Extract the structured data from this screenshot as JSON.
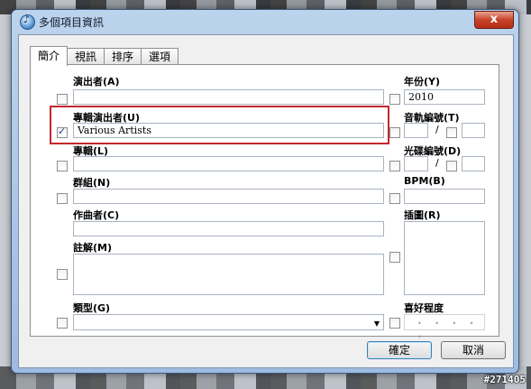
{
  "window": {
    "title": "多個項目資訊",
    "close_label": "x"
  },
  "tabs": [
    {
      "label": "簡介",
      "active": true
    },
    {
      "label": "視訊",
      "active": false
    },
    {
      "label": "排序",
      "active": false
    },
    {
      "label": "選項",
      "active": false
    }
  ],
  "fields": {
    "artist": {
      "label": "演出者(A)",
      "value": "",
      "checked": false
    },
    "album_artist": {
      "label": "專輯演出者(U)",
      "value": "Various Artists",
      "checked": true
    },
    "album": {
      "label": "專輯(L)",
      "value": "",
      "checked": false
    },
    "grouping": {
      "label": "群組(N)",
      "value": "",
      "checked": false
    },
    "composer": {
      "label": "作曲者(C)",
      "value": "",
      "checked": false
    },
    "comments": {
      "label": "註解(M)",
      "value": "",
      "checked": false
    },
    "genre": {
      "label": "類型(G)",
      "value": "",
      "checked": false
    },
    "year": {
      "label": "年份(Y)",
      "value": "2010",
      "checked": false
    },
    "track_number": {
      "label": "音軌編號(T)",
      "separator": "/",
      "checked": false
    },
    "disc_number": {
      "label": "光碟編號(D)",
      "separator": "/",
      "checked": false
    },
    "bpm": {
      "label": "BPM(B)",
      "value": "",
      "checked": false
    },
    "artwork": {
      "label": "插圖(R)",
      "checked": false
    },
    "rating": {
      "label": "喜好程度",
      "stars": "• • • • •",
      "checked": false
    }
  },
  "buttons": {
    "ok": "確定",
    "cancel": "取消"
  },
  "watermark": "#271405",
  "colors": {
    "highlight": "#c3282e",
    "close": "#c7432b"
  }
}
